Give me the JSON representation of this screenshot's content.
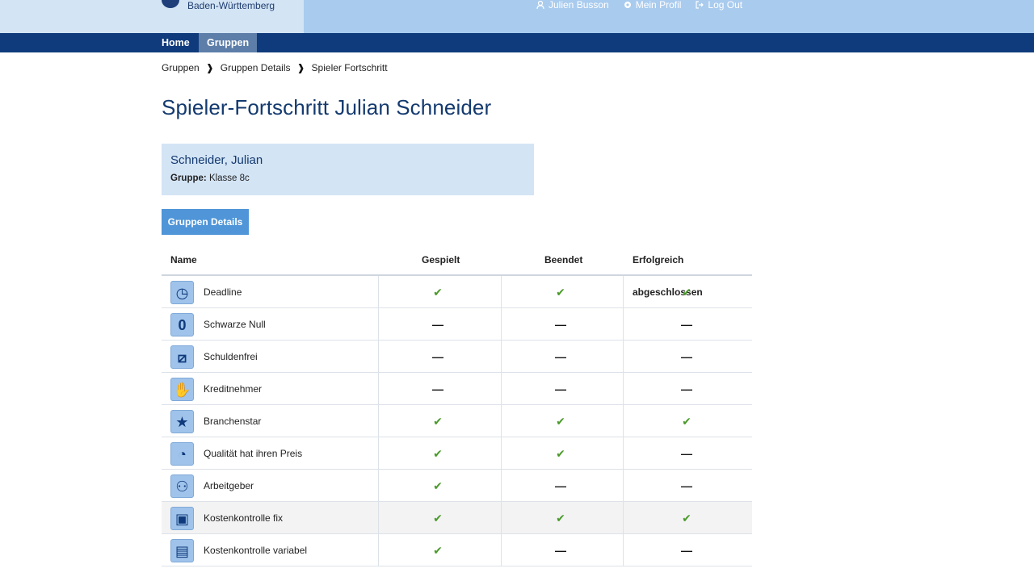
{
  "header": {
    "brand_text": "Baden-Württemberg",
    "user_name": "Julien Busson",
    "profile_label": "Mein Profil",
    "logout_label": "Log Out"
  },
  "nav": {
    "items": [
      {
        "label": "Home",
        "active": false
      },
      {
        "label": "Gruppen",
        "active": true
      }
    ]
  },
  "breadcrumb": {
    "items": [
      "Gruppen",
      "Gruppen Details",
      "Spieler Fortschritt"
    ],
    "separator": "❱"
  },
  "page": {
    "title": "Spieler-Fortschritt Julian Schneider"
  },
  "player": {
    "name": "Schneider, Julian",
    "group_label": "Gruppe:",
    "group_value": "Klasse 8c"
  },
  "actions": {
    "group_details_button": "Gruppen Details"
  },
  "table": {
    "headers": [
      "Name",
      "Gespielt",
      "Beendet",
      "Erfolgreich abgeschlossen"
    ],
    "rows": [
      {
        "name": "Deadline",
        "icon": "clock-icon",
        "glyph": "◷",
        "played": true,
        "finished": true,
        "success": true
      },
      {
        "name": "Schwarze Null",
        "icon": "zero-icon",
        "glyph": "0",
        "played": false,
        "finished": false,
        "success": false
      },
      {
        "name": "Schuldenfrei",
        "icon": "no-debt-icon",
        "glyph": "⧄",
        "played": false,
        "finished": false,
        "success": false
      },
      {
        "name": "Kreditnehmer",
        "icon": "borrower-icon",
        "glyph": "✋",
        "played": false,
        "finished": false,
        "success": false
      },
      {
        "name": "Branchenstar",
        "icon": "star-icon",
        "glyph": "★",
        "played": true,
        "finished": true,
        "success": true
      },
      {
        "name": "Qualität hat ihren Preis",
        "icon": "quality-icon",
        "glyph": "◔",
        "played": true,
        "finished": true,
        "success": false
      },
      {
        "name": "Arbeitgeber",
        "icon": "handshake-icon",
        "glyph": "⚇",
        "played": true,
        "finished": false,
        "success": false
      },
      {
        "name": "Kostenkontrolle fix",
        "icon": "boxes-icon",
        "glyph": "▣",
        "played": true,
        "finished": true,
        "success": true
      },
      {
        "name": "Kostenkontrolle variabel",
        "icon": "boxes-variable-icon",
        "glyph": "▤",
        "played": true,
        "finished": false,
        "success": false
      }
    ],
    "symbols": {
      "check": "✔",
      "dash": "—"
    }
  },
  "colors": {
    "nav_bg": "#0f3a7c",
    "topbar_bg": "#a9cbee",
    "brand_bg": "#d3e4f5",
    "accent_button": "#4f95d8",
    "title_color": "#143a6f",
    "check_color": "#4a9a2b"
  }
}
